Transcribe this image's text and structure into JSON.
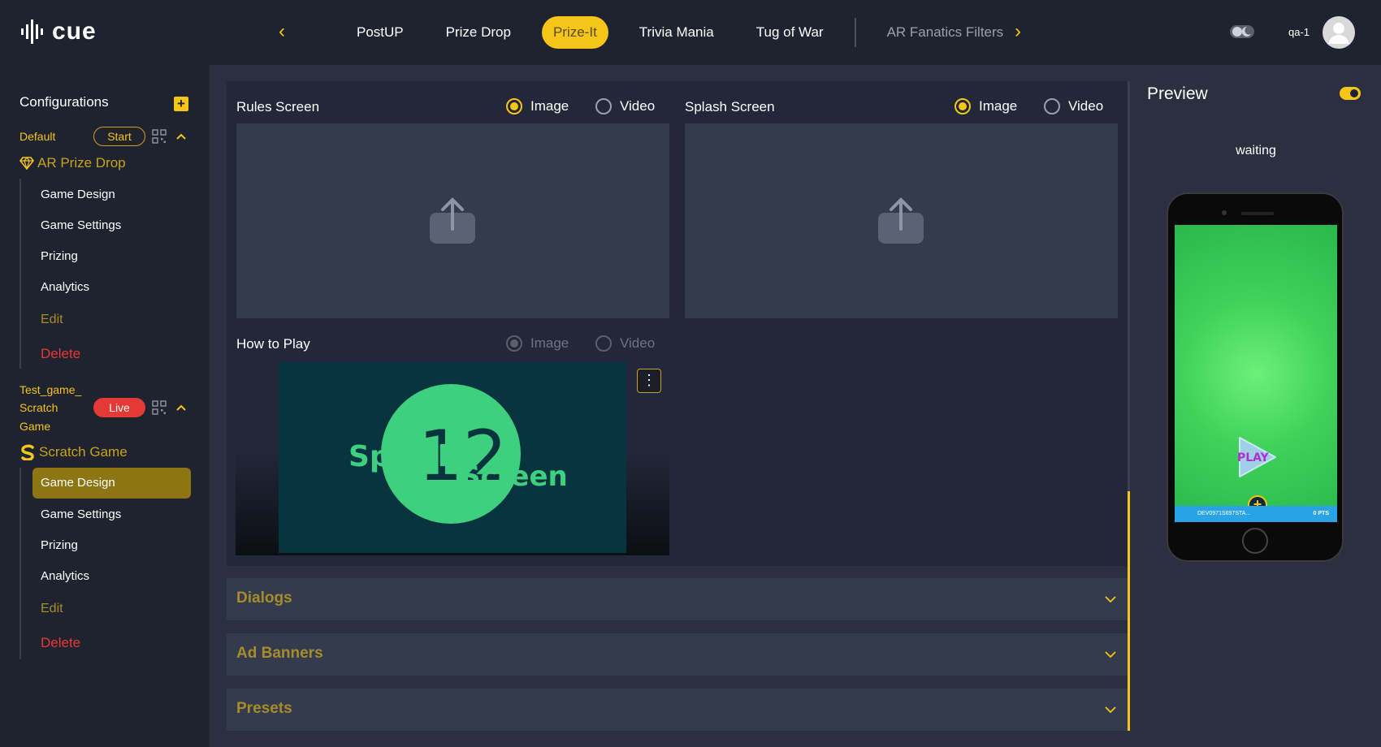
{
  "app": {
    "logo_text": "cue"
  },
  "topnav": {
    "tabs": [
      {
        "label": "PostUP"
      },
      {
        "label": "Prize Drop"
      },
      {
        "label": "Prize-It"
      },
      {
        "label": "Trivia Mania"
      },
      {
        "label": "Tug of War"
      },
      {
        "label": "AR Fanatics Filters"
      }
    ],
    "active_tab": "Prize-It",
    "user": "qa-1"
  },
  "sidebar": {
    "title": "Configurations",
    "groups": [
      {
        "name": "Default",
        "status": "Start",
        "game_type": "AR Prize Drop",
        "items": [
          "Game Design",
          "Game Settings",
          "Prizing",
          "Analytics",
          "Edit",
          "Delete"
        ]
      },
      {
        "name_lines": [
          "Test_game_",
          "Scratch",
          "Game"
        ],
        "status": "Live",
        "game_type": "Scratch Game",
        "items": [
          "Game Design",
          "Game Settings",
          "Prizing",
          "Analytics",
          "Edit",
          "Delete"
        ],
        "active_item": "Game Design"
      }
    ]
  },
  "main": {
    "rules_screen": {
      "label": "Rules Screen",
      "options": [
        "Image",
        "Video"
      ],
      "selected": "Image"
    },
    "splash_screen": {
      "label": "Splash Screen",
      "options": [
        "Image",
        "Video"
      ],
      "selected": "Image"
    },
    "how_to_play": {
      "label": "How to Play",
      "options": [
        "Image",
        "Video"
      ],
      "selected": "Image",
      "media_text_1": "Splash",
      "media_text_2": "Screen",
      "media_number": "12"
    },
    "accordions": [
      "Dialogs",
      "Ad Banners",
      "Presets"
    ]
  },
  "preview": {
    "title": "Preview",
    "status": "waiting",
    "play_label": "PLAY",
    "bar_id": "DEV0971S697STA...",
    "bar_pts": "0 PTS"
  },
  "colors": {
    "accent": "#f5c518",
    "live": "#e53935",
    "bg": "#1f2330",
    "panel": "#22283a"
  }
}
